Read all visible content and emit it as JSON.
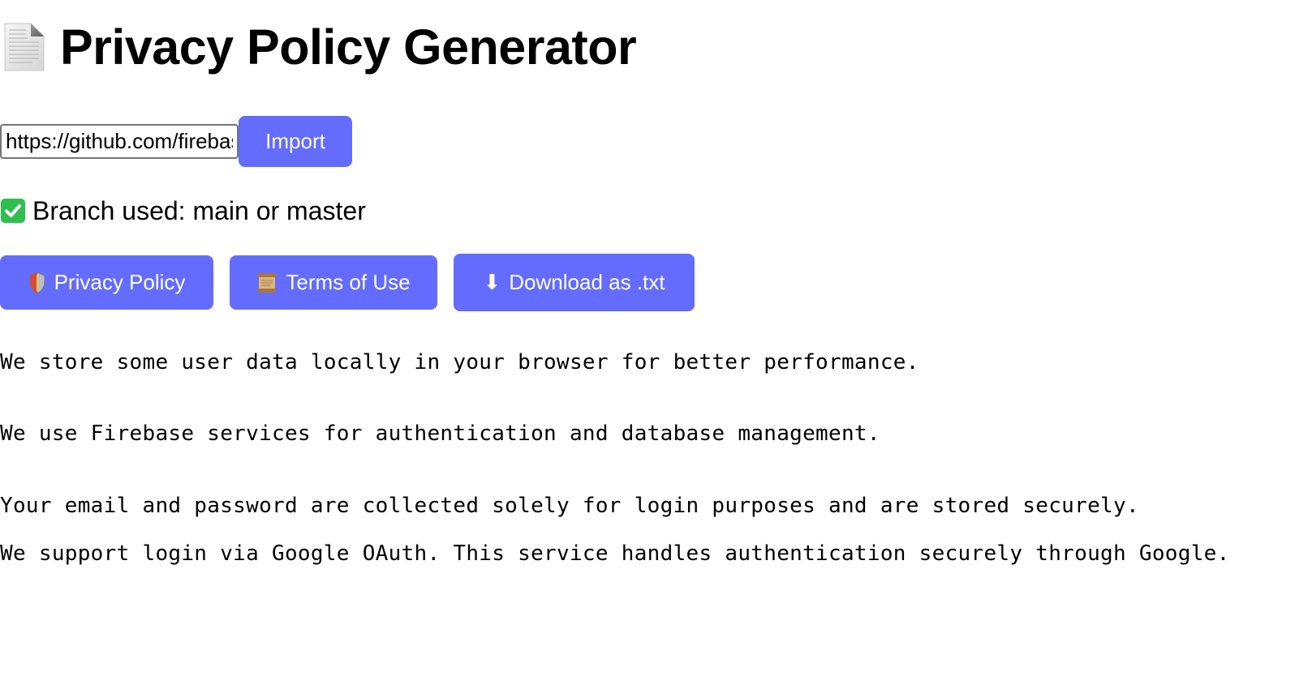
{
  "header": {
    "icon": "document-icon",
    "title": "Privacy Policy Generator"
  },
  "import": {
    "input_value": "https://github.com/firebase",
    "button_label": "Import"
  },
  "status": {
    "icon": "check-mark-icon",
    "text": "Branch used: main or master"
  },
  "actions": {
    "privacy_icon": "shield-icon",
    "privacy_label": "Privacy Policy",
    "terms_icon": "scroll-icon",
    "terms_label": "Terms of Use",
    "download_icon": "download-arrow-icon",
    "download_glyph": "⬇",
    "download_label": "Download as .txt"
  },
  "policy": {
    "lines": [
      "We store some user data locally in your browser for better performance.",
      "We use Firebase services for authentication and database management.",
      "Your email and password are collected solely for login purposes and are stored securely.",
      "We support login via Google OAuth. This service handles authentication securely through Google."
    ]
  },
  "colors": {
    "accent": "#646cff",
    "button_text": "#ffffff",
    "check_green": "#2fbf4f"
  }
}
